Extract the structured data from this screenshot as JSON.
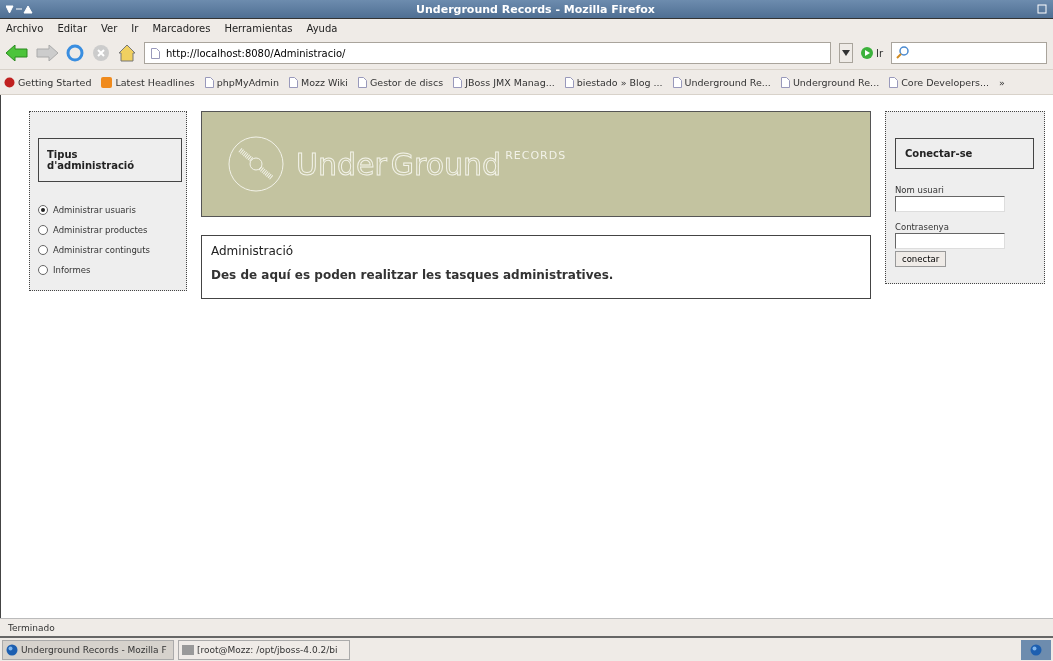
{
  "window": {
    "title": "Underground Records - Mozilla Firefox"
  },
  "menu": [
    "Archivo",
    "Editar",
    "Ver",
    "Ir",
    "Marcadores",
    "Herramientas",
    "Ayuda"
  ],
  "address": {
    "value": "http://localhost:8080/Administracio/"
  },
  "go_button": "Ir",
  "bookmarks": [
    {
      "label": "Getting Started",
      "kind": "start"
    },
    {
      "label": "Latest Headlines",
      "kind": "feed"
    },
    {
      "label": "phpMyAdmin",
      "kind": "page"
    },
    {
      "label": "Mozz Wiki",
      "kind": "page"
    },
    {
      "label": "Gestor de discs",
      "kind": "page"
    },
    {
      "label": "JBoss JMX Manag...",
      "kind": "page"
    },
    {
      "label": "biestado » Blog ...",
      "kind": "page"
    },
    {
      "label": "Underground Re...",
      "kind": "page"
    },
    {
      "label": "Underground Re...",
      "kind": "page"
    },
    {
      "label": "Core Developers...",
      "kind": "page"
    }
  ],
  "bookmarks_more": "»",
  "admin_panel": {
    "title": "Tipus d'administració",
    "options": [
      {
        "label": "Administrar usuaris",
        "selected": true
      },
      {
        "label": "Administrar productes",
        "selected": false
      },
      {
        "label": "Administrar continguts",
        "selected": false
      },
      {
        "label": "Informes",
        "selected": false
      }
    ]
  },
  "banner": {
    "logo_main_1": "Under",
    "logo_main_2": "Ground",
    "logo_sub": "RECORDS"
  },
  "content": {
    "heading": "Administració",
    "text": "Des de aquí es poden realitzar les tasques administratives."
  },
  "login_panel": {
    "title": "Conectar-se",
    "user_label": "Nom usuari",
    "password_label": "Contrasenya",
    "button": "conectar"
  },
  "status_bar": "Terminado",
  "taskbar": [
    {
      "label": "Underground Records - Mozilla F",
      "selected": true
    },
    {
      "label": "[root@Mozz: /opt/jboss-4.0.2/bi",
      "selected": false
    }
  ]
}
